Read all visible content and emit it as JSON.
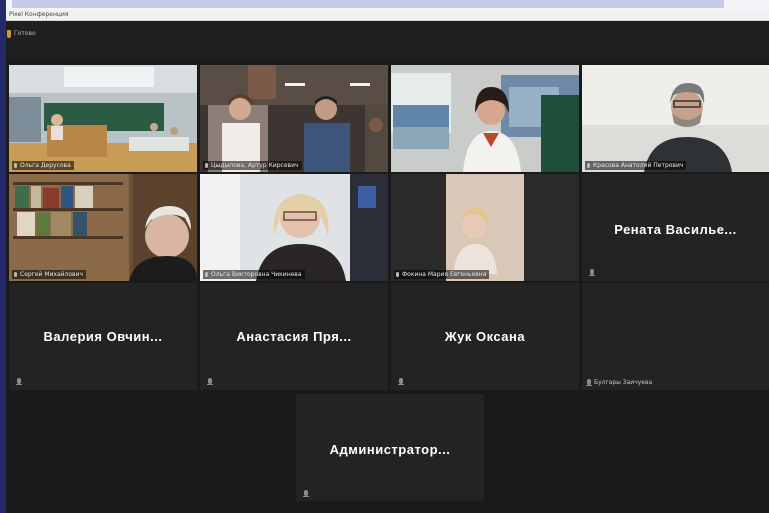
{
  "window": {
    "title": "Pixel Конференция"
  },
  "meeting": {
    "info_label": "Готово"
  },
  "participants": [
    {
      "tag": "Ольга Дерусова"
    },
    {
      "tag": "Цыдыпова, Артур Кирсевич"
    },
    {
      "tag": ""
    },
    {
      "tag": "Красова Анатолий Петрович"
    },
    {
      "tag": "Сергей Михайлович"
    },
    {
      "tag": "Ольга Викторовна Чикинева"
    },
    {
      "tag": "Фокина Мария Евгеньевна"
    },
    {
      "display_name": "Рената  Василье..."
    },
    {
      "display_name": "Валерия  Овчин..."
    },
    {
      "display_name": "Анастасия  Пря..."
    },
    {
      "display_name": "Жук Оксана"
    },
    {
      "tag": "Булгары Заичуева"
    },
    {
      "display_name": "Администратор..."
    }
  ],
  "icons": {
    "mic": "microphone-icon",
    "shield": "shield-icon"
  },
  "colors": {
    "background": "#1a1a1a",
    "tile": "#232323",
    "active_speaker": "#c9cc8c",
    "sidebar": "#252a6b"
  }
}
